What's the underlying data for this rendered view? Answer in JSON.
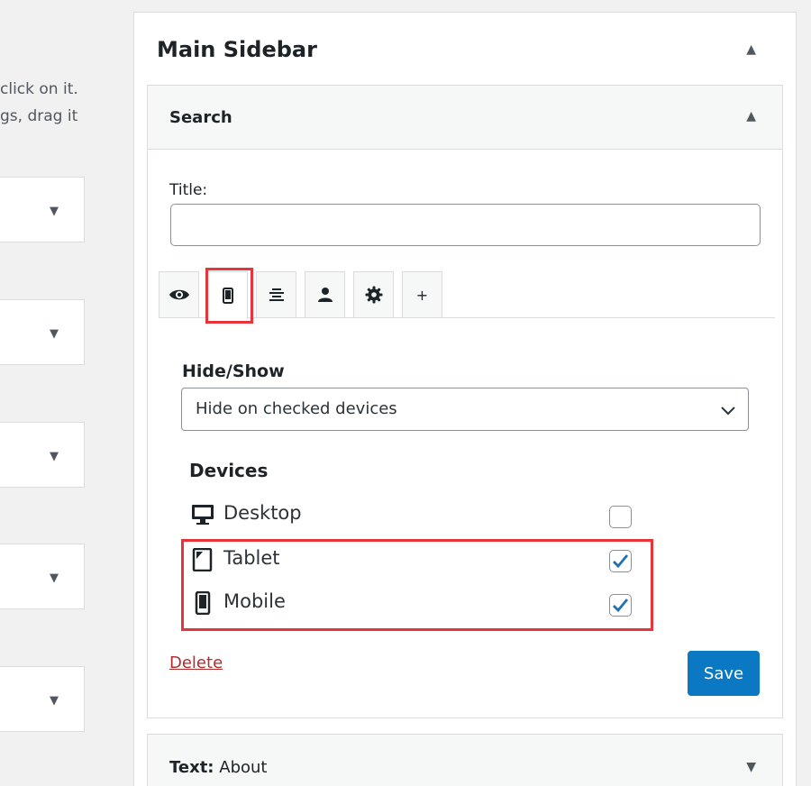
{
  "left": {
    "help_lines": [
      "click on it.",
      "gs, drag it"
    ],
    "widget_arrow": "▼"
  },
  "sidebar": {
    "title": "Main Sidebar",
    "toggle": "▲"
  },
  "search_widget": {
    "title": "Search",
    "toggle": "▲",
    "title_label": "Title:",
    "title_value": "",
    "tabs": [
      {
        "name": "visibility",
        "icon": "eye-icon"
      },
      {
        "name": "devices",
        "icon": "mobile-icon"
      },
      {
        "name": "alignment",
        "icon": "align-icon"
      },
      {
        "name": "user-roles",
        "icon": "user-icon"
      },
      {
        "name": "settings",
        "icon": "gear-icon"
      },
      {
        "name": "more",
        "icon": "plus-icon",
        "label": "+"
      }
    ],
    "hide_show_label": "Hide/Show",
    "hide_show_value": "Hide on checked devices",
    "devices_label": "Devices",
    "devices": [
      {
        "label": "Desktop",
        "icon": "desktop-icon",
        "checked": false
      },
      {
        "label": "Tablet",
        "icon": "tablet-icon",
        "checked": true
      },
      {
        "label": "Mobile",
        "icon": "mobile-icon",
        "checked": true
      }
    ],
    "delete_label": "Delete",
    "save_label": "Save"
  },
  "text_widget": {
    "prefix": "Text:",
    "name": "About",
    "toggle": "▼"
  },
  "colors": {
    "highlight": "#e8333a",
    "save_button": "#0a78c2",
    "delete_link": "#b32d2e",
    "checkmark": "#2271b1"
  }
}
